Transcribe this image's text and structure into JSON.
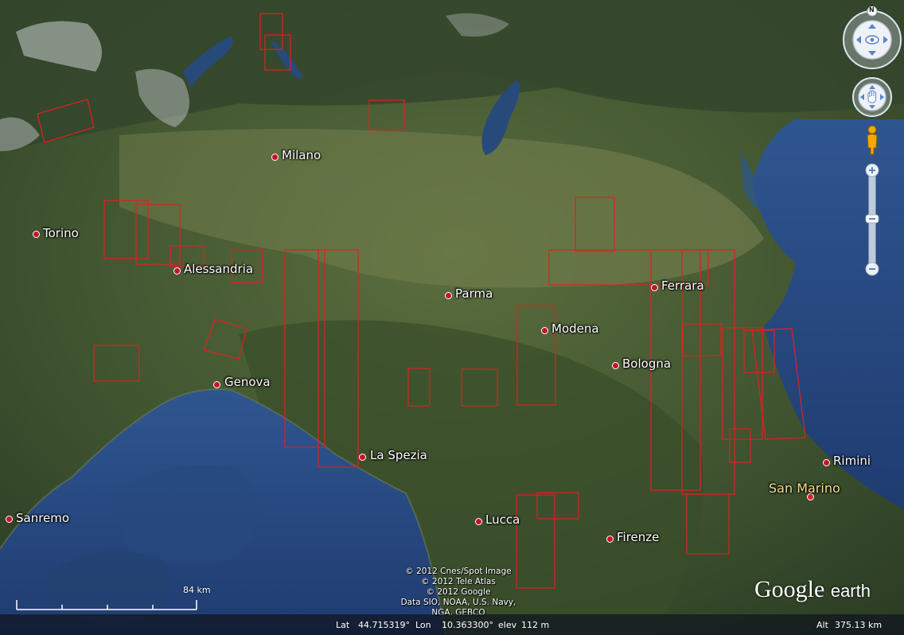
{
  "cities": [
    {
      "name": "Milano",
      "kind": "city"
    },
    {
      "name": "Torino",
      "kind": "city"
    },
    {
      "name": "Alessandria",
      "kind": "city"
    },
    {
      "name": "Parma",
      "kind": "city"
    },
    {
      "name": "Ferrara",
      "kind": "city"
    },
    {
      "name": "Modena",
      "kind": "city"
    },
    {
      "name": "Bologna",
      "kind": "city"
    },
    {
      "name": "Genova",
      "kind": "city"
    },
    {
      "name": "La Spezia",
      "kind": "city"
    },
    {
      "name": "Rimini",
      "kind": "city"
    },
    {
      "name": "San Marino",
      "kind": "country"
    },
    {
      "name": "Sanremo",
      "kind": "city"
    },
    {
      "name": "Lucca",
      "kind": "city"
    },
    {
      "name": "Firenze",
      "kind": "city"
    }
  ],
  "copyright": [
    "© 2012 Cnes/Spot Image",
    "© 2012 Tele Atlas",
    "© 2012 Google",
    "Data SIO, NOAA, U.S. Navy, NGA, GEBCO"
  ],
  "scale": {
    "label": "84 km"
  },
  "status": {
    "lat_label": "Lat",
    "lat_value": "44.715319°",
    "lon_label": "Lon",
    "lon_value": "10.363300°",
    "elev_label": "elev",
    "elev_value": "112 m",
    "alt_label": "Alt",
    "alt_value": "375.13 km"
  },
  "logo": {
    "google": "Google",
    "earth": "earth"
  },
  "compass": {
    "north_label": "N"
  },
  "colors": {
    "sea": "#2c4f86",
    "overlay": "#e02020",
    "city_dot": "#c8102e"
  }
}
